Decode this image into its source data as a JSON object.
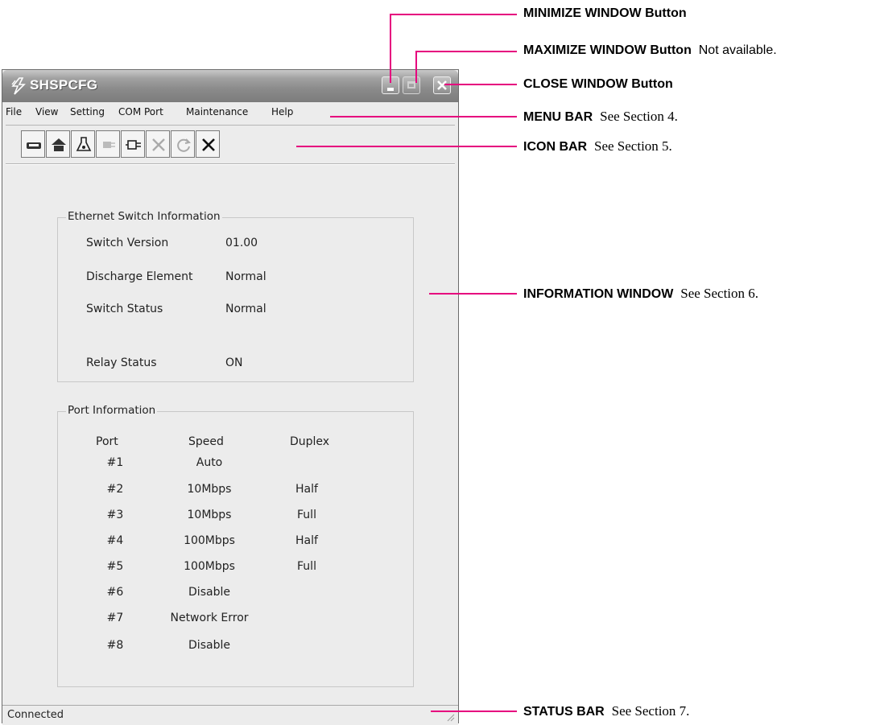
{
  "window": {
    "title": "SHSPCFG",
    "menu": [
      "File",
      "View",
      "Setting",
      "COM Port",
      "Maintenance",
      "Help"
    ],
    "toolbar_icons": [
      "card-icon",
      "home-icon",
      "flask-icon",
      "plug-icon",
      "plug-connect-icon",
      "tools-icon",
      "refresh-icon",
      "close-x-icon"
    ]
  },
  "switch_info": {
    "legend": "Ethernet Switch Information",
    "rows": [
      {
        "label": "Switch Version",
        "value": "01.00"
      },
      {
        "label": "Discharge Element",
        "value": "Normal"
      },
      {
        "label": "Switch Status",
        "value": "Normal"
      },
      {
        "label": "Relay Status",
        "value": "ON"
      }
    ]
  },
  "port_info": {
    "legend": "Port Information",
    "headers": [
      "Port",
      "Speed",
      "Duplex"
    ],
    "rows": [
      {
        "port": "#1",
        "speed": "Auto",
        "duplex": ""
      },
      {
        "port": "#2",
        "speed": "10Mbps",
        "duplex": "Half"
      },
      {
        "port": "#3",
        "speed": "10Mbps",
        "duplex": "Full"
      },
      {
        "port": "#4",
        "speed": "100Mbps",
        "duplex": "Half"
      },
      {
        "port": "#5",
        "speed": "100Mbps",
        "duplex": "Full"
      },
      {
        "port": "#6",
        "speed": "Disable",
        "duplex": ""
      },
      {
        "port": "#7",
        "speed": "Network Error",
        "duplex": ""
      },
      {
        "port": "#8",
        "speed": "Disable",
        "duplex": ""
      }
    ]
  },
  "status_bar": {
    "text": "Connected"
  },
  "annotations": {
    "minimize": {
      "title": "MINIMIZE WINDOW Button",
      "note": ""
    },
    "maximize": {
      "title": "MAXIMIZE WINDOW Button",
      "note": "Not available."
    },
    "close": {
      "title": "CLOSE WINDOW Button",
      "note": ""
    },
    "menu_bar": {
      "title": "MENU BAR",
      "note": "See Section 4."
    },
    "icon_bar": {
      "title": "ICON BAR",
      "note": "See Section 5."
    },
    "info_window": {
      "title": "INFORMATION WINDOW",
      "note": "See Section 6."
    },
    "status_bar": {
      "title": "STATUS BAR",
      "note": "See Section 7."
    }
  },
  "colors": {
    "annotation_line": "#e6007e",
    "window_bg": "#ececec",
    "titlebar": "#8a8a8a"
  }
}
